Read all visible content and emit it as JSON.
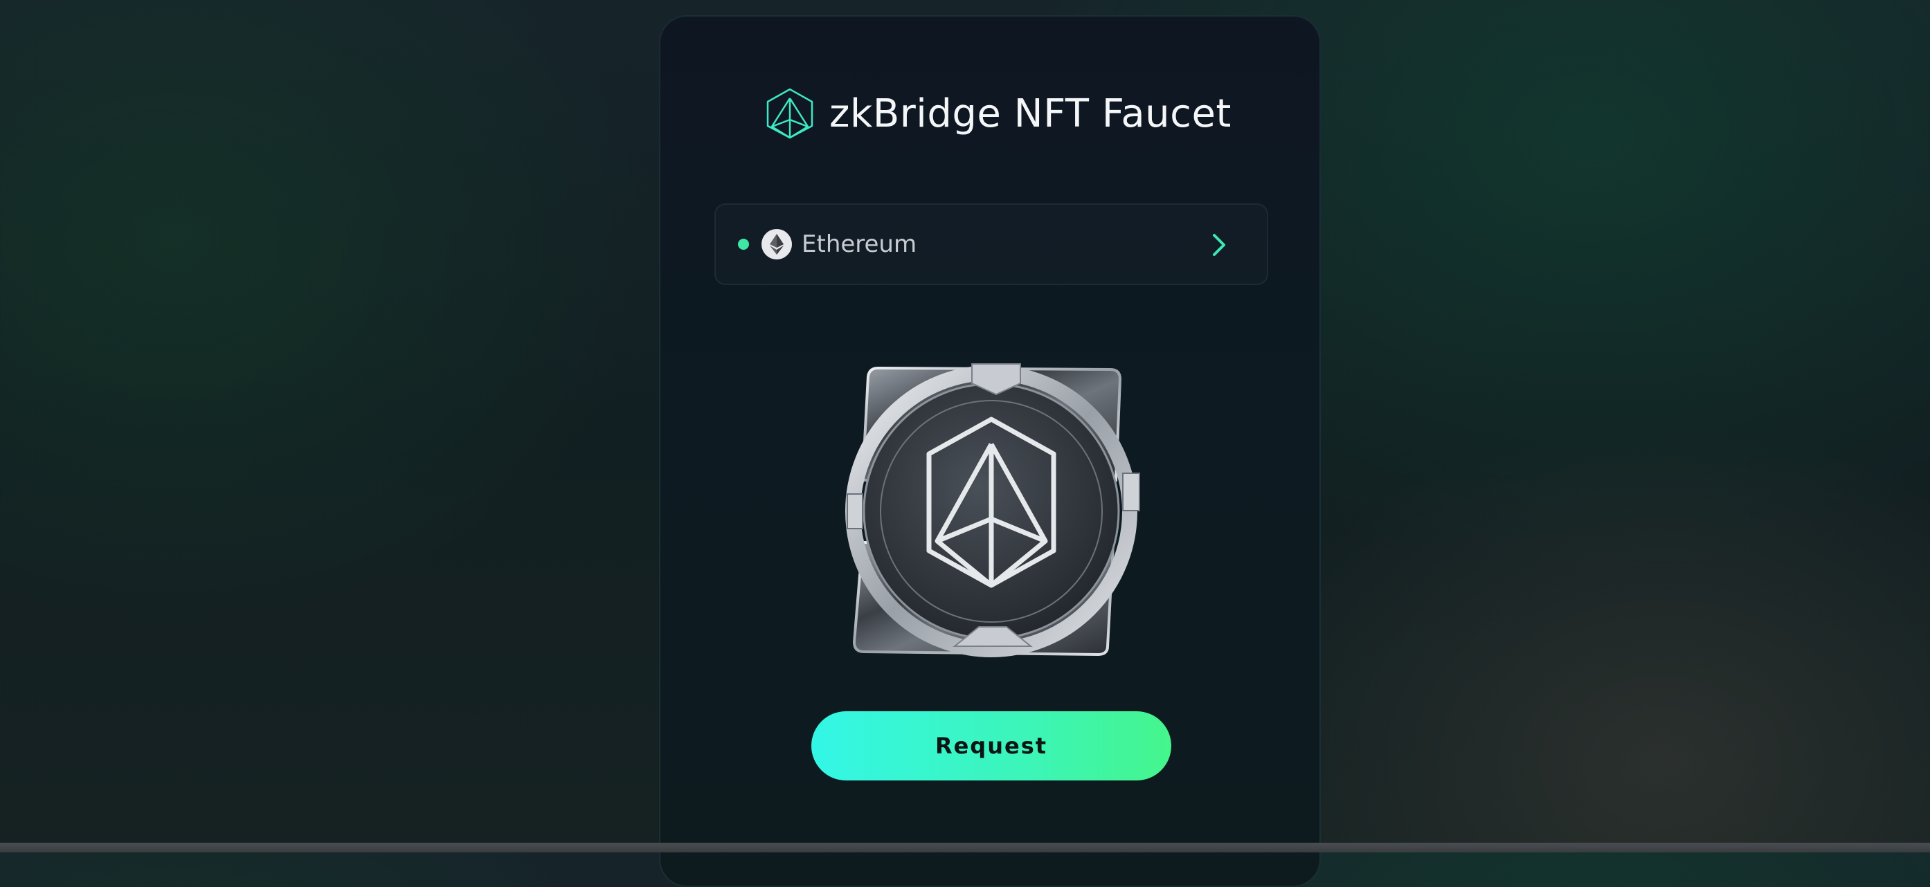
{
  "header": {
    "title": "zkBridge NFT Faucet",
    "logo_icon": "zkbridge-logo-icon"
  },
  "chain_selector": {
    "label": "Ethereum",
    "status_color": "#3ee8a4",
    "chain_icon": "ethereum-icon",
    "arrow_icon": "chevron-right-icon"
  },
  "nft_preview": {
    "icon": "zkbridge-nft-badge"
  },
  "request_button": {
    "label": "Request"
  },
  "colors": {
    "accent": "#3ee8a4",
    "button_gradient_start": "#34f6e6",
    "button_gradient_end": "#45f58c"
  }
}
